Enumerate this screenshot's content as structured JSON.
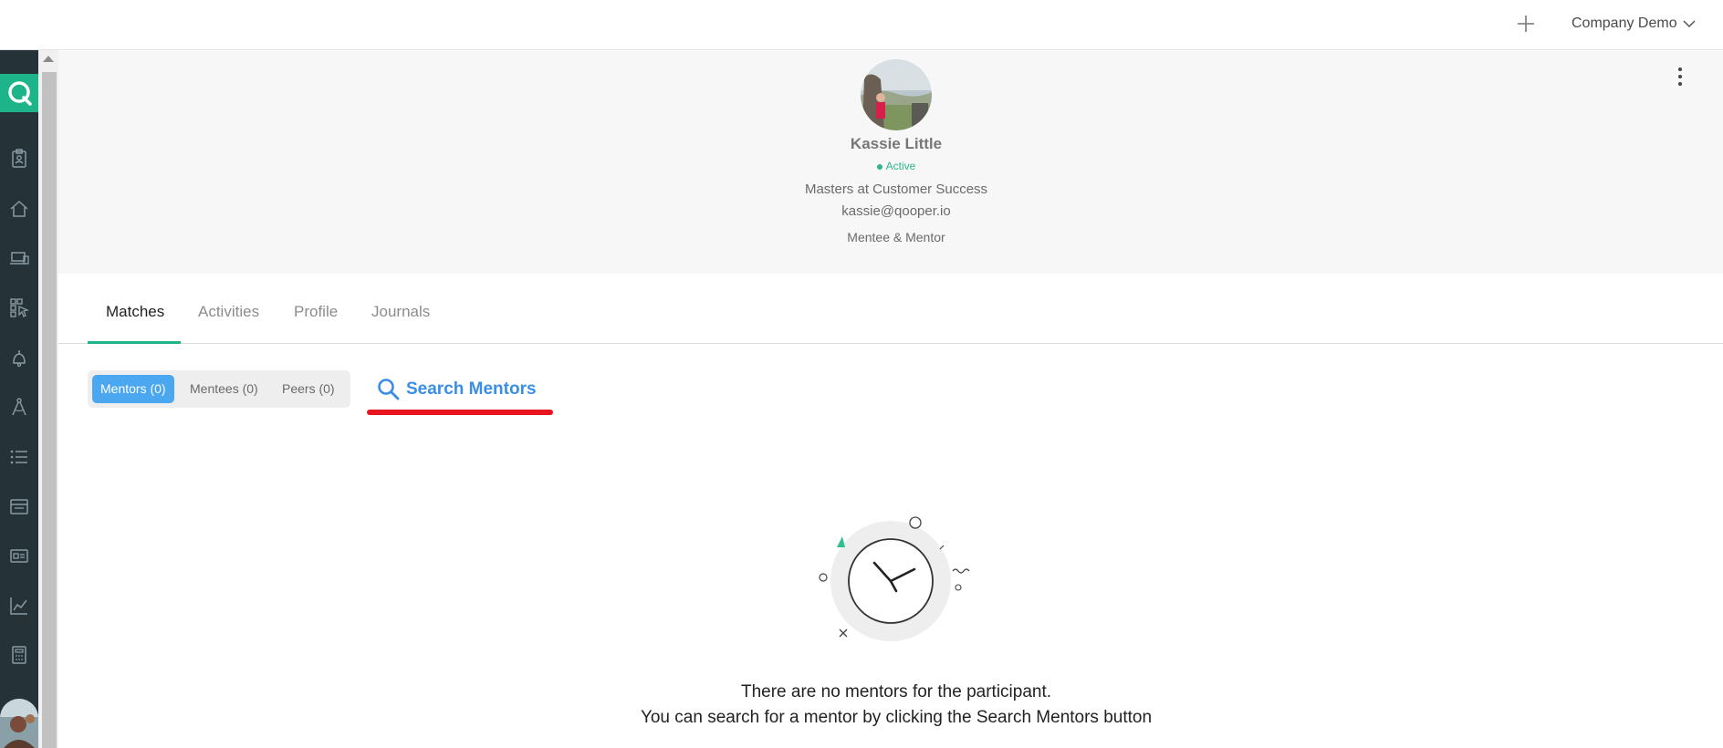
{
  "topbar": {
    "company_label": "Company Demo",
    "add_icon": "plus-icon",
    "dropdown_icon": "chevron-down-icon"
  },
  "sidenav": {
    "logo_letter": "Q",
    "items": [
      {
        "icon": "badge-icon"
      },
      {
        "icon": "home-icon"
      },
      {
        "icon": "laptop-icon"
      },
      {
        "icon": "grid-cursor-icon"
      },
      {
        "icon": "bell-icon"
      },
      {
        "icon": "compass-icon"
      },
      {
        "icon": "list-icon"
      },
      {
        "icon": "calendar-icon"
      },
      {
        "icon": "card-icon"
      },
      {
        "icon": "chart-icon"
      },
      {
        "icon": "calculator-icon"
      }
    ]
  },
  "profile": {
    "name": "Kassie Little",
    "status": "Active",
    "title": "Masters at Customer Success",
    "email": "kassie@qooper.io",
    "role": "Mentee & Mentor"
  },
  "tabs": [
    {
      "label": "Matches",
      "active": true
    },
    {
      "label": "Activities",
      "active": false
    },
    {
      "label": "Profile",
      "active": false
    },
    {
      "label": "Journals",
      "active": false
    }
  ],
  "filters": [
    {
      "label": "Mentors (0)",
      "active": true
    },
    {
      "label": "Mentees (0)",
      "active": false
    },
    {
      "label": "Peers (0)",
      "active": false
    }
  ],
  "search": {
    "label": "Search Mentors"
  },
  "empty_state": {
    "line1": "There are no mentors for the participant.",
    "line2": "You can search for a mentor by clicking the Search Mentors button"
  },
  "colors": {
    "accent_green": "#1db48a",
    "sidebar_bg": "#253238",
    "filter_active": "#4ba7ef",
    "search_blue": "#3a8ee6",
    "annotation_red": "#e8141e"
  }
}
